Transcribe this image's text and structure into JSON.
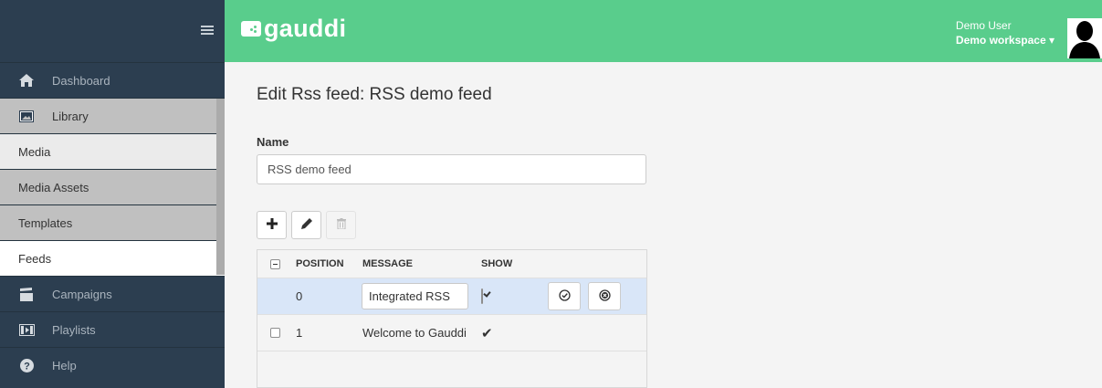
{
  "app": {
    "logo_text": "gauddi",
    "brand_color": "#59cd8c",
    "sidebar_color": "#2c3e50"
  },
  "header": {
    "user_name": "Demo User",
    "workspace": "Demo workspace",
    "workspace_caret": "▾"
  },
  "sidebar": {
    "items": [
      {
        "label": "Dashboard",
        "icon": "home-icon"
      },
      {
        "label": "Library",
        "icon": "image-icon"
      },
      {
        "label": "Media"
      },
      {
        "label": "Media Assets"
      },
      {
        "label": "Templates"
      },
      {
        "label": "Feeds"
      },
      {
        "label": "Campaigns",
        "icon": "clapperboard-icon"
      },
      {
        "label": "Playlists",
        "icon": "film-icon"
      },
      {
        "label": "Help",
        "icon": "question-icon"
      }
    ]
  },
  "page": {
    "title": "Edit Rss feed: RSS demo feed",
    "name_label": "Name",
    "name_value": "RSS demo feed"
  },
  "grid": {
    "headers": {
      "position": "POSITION",
      "message": "MESSAGE",
      "show": "SHOW"
    },
    "rows": [
      {
        "position": "0",
        "message": "Integrated RSS",
        "show": true,
        "editing": true
      },
      {
        "position": "1",
        "message": "Welcome to Gauddi",
        "show": true,
        "show_mark": "✔",
        "editing": false
      }
    ]
  }
}
